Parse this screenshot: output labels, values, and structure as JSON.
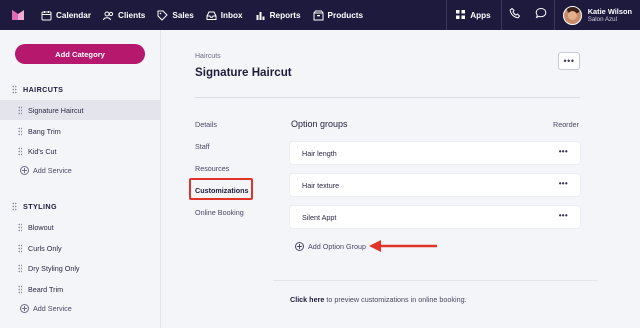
{
  "nav": {
    "items": [
      {
        "label": "Calendar",
        "icon": "calendar-icon"
      },
      {
        "label": "Clients",
        "icon": "clients-icon"
      },
      {
        "label": "Sales",
        "icon": "tag-icon"
      },
      {
        "label": "Inbox",
        "icon": "inbox-icon"
      },
      {
        "label": "Reports",
        "icon": "bar-chart-icon"
      },
      {
        "label": "Products",
        "icon": "box-icon"
      }
    ],
    "apps_label": "Apps",
    "user": {
      "name": "Katie Wilson",
      "business": "Salon Azul"
    }
  },
  "sidebar": {
    "add_category_label": "Add Category",
    "categories": [
      {
        "name": "HAIRCUTS",
        "services": [
          "Signature Haircut",
          "Bang Trim",
          "Kid's Cut"
        ],
        "add_service_label": "Add Service"
      },
      {
        "name": "STYLING",
        "services": [
          "Blowout",
          "Curls Only",
          "Dry Styling Only",
          "Beard Trim"
        ],
        "add_service_label": "Add Service"
      }
    ],
    "active_service": "Signature Haircut"
  },
  "main": {
    "breadcrumb": "Haircuts",
    "title": "Signature Haircut",
    "more_label": "•••",
    "subnav": [
      "Details",
      "Staff",
      "Resources",
      "Customizations",
      "Online Booking"
    ],
    "active_subnav": "Customizations",
    "section_title": "Option groups",
    "reorder_label": "Reorder",
    "option_groups": [
      "Hair length",
      "Hair texture",
      "Silent Appt"
    ],
    "row_menu_label": "•••",
    "add_option_group_label": "Add Option Group",
    "footer_link": "Click here",
    "footer_text": " to preview customizations in online booking."
  },
  "colors": {
    "topbar": "#1d1a3d",
    "accent": "#b5186d",
    "highlight": "#e0342b"
  }
}
